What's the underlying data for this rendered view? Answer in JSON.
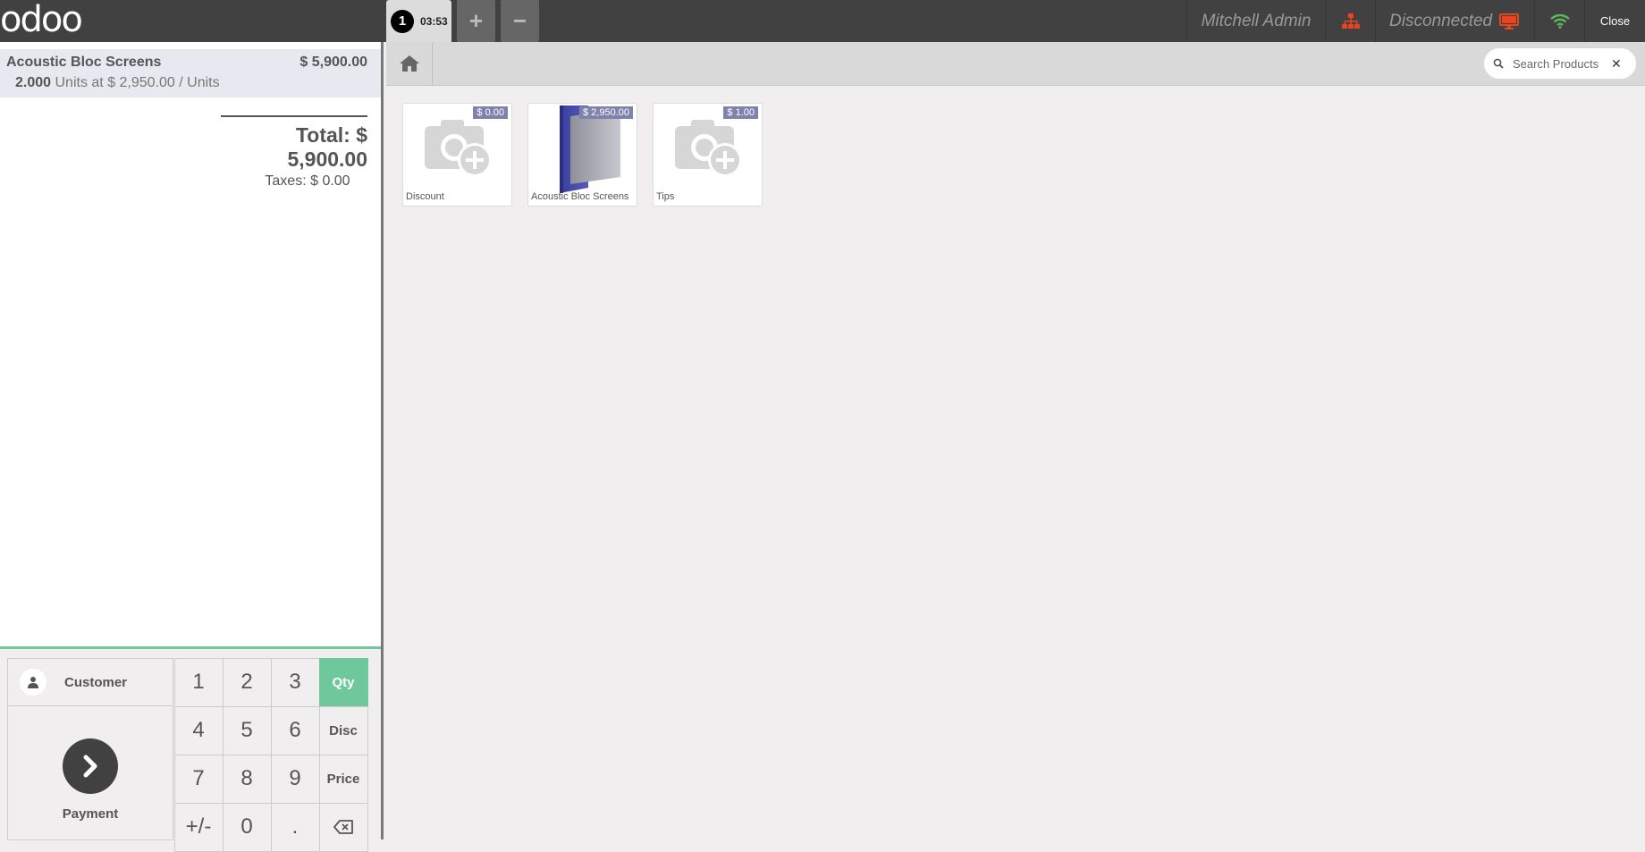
{
  "header": {
    "logo": "odoo",
    "order_number": "1",
    "order_time": "03:53",
    "add_order": "+",
    "remove_order": "−",
    "cashier": "Mitchell Admin",
    "proxy_status": "Disconnected",
    "close_label": "Close"
  },
  "order": {
    "lines": [
      {
        "product": "Acoustic Bloc Screens",
        "price": "$ 5,900.00",
        "qty": "2.000",
        "unit_info": "Units at $ 2,950.00 / Units"
      }
    ],
    "total": "Total: $ 5,900.00",
    "taxes": "Taxes: $ 0.00"
  },
  "controls": {
    "customer": "Customer",
    "payment": "Payment",
    "keys": [
      "1",
      "2",
      "3",
      "Qty",
      "4",
      "5",
      "6",
      "Disc",
      "7",
      "8",
      "9",
      "Price",
      "+/-",
      "0",
      ".",
      "⌫"
    ],
    "active_mode": "Qty"
  },
  "search": {
    "placeholder": "Search Products"
  },
  "products": [
    {
      "name": "Discount",
      "price": "$ 0.00"
    },
    {
      "name": "Acoustic Bloc Screens",
      "price": "$ 2,950.00"
    },
    {
      "name": "Tips",
      "price": "$ 1.00"
    }
  ],
  "colors": {
    "topbar": "#414141",
    "accent_green": "#6ec89b",
    "price_tag": "#7f82ac",
    "proxy_red": "#e8441f",
    "wifi_green": "#5cb85c"
  }
}
